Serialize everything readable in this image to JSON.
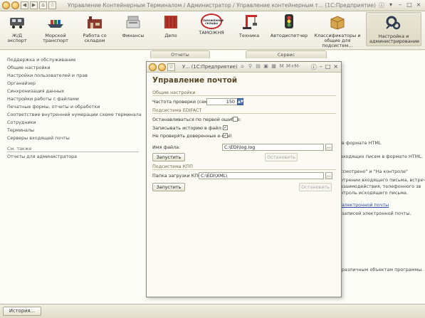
{
  "window": {
    "title": "Управление Контейнерным Терминалом / Администратор / Управление контейнерным т...  (1С:Предприятие)"
  },
  "sections": [
    {
      "label": "Ж/Д\nэкспорт",
      "icon": "train-icon"
    },
    {
      "label": "Морской\nтранспорт",
      "icon": "ship-icon"
    },
    {
      "label": "Работа со\nскладом",
      "icon": "warehouse-icon"
    },
    {
      "label": "Финансы",
      "icon": "finance-icon"
    },
    {
      "label": "Депо",
      "icon": "container-icon"
    },
    {
      "label": "ТАМОЖНЯ",
      "icon": "customs-icon"
    },
    {
      "label": "Техника",
      "icon": "crane-icon"
    },
    {
      "label": "Автодиспетчер",
      "icon": "traffic-light-icon"
    },
    {
      "label": "Классификаторы и\nобщие для подсистем...",
      "icon": "box-icon"
    },
    {
      "label": "Настройка и\nадминистрирование",
      "icon": "settings-icon"
    }
  ],
  "customs_icon_text": "ТАМОЖЕННЫЕ\nСКЛАДЫ",
  "leftpane": {
    "items": [
      "Поддержка и обслуживание",
      "Общие настройки",
      "Настройки пользователей и прав",
      "Органайзер",
      "Синхронизация данных",
      "Настройки работы с файлами",
      "Печатные формы, отчеты и обработки",
      "Соответствие внутренней нумерации схеме терминала",
      "Сотрудники",
      "Терминалы",
      "Серверы входящей почты"
    ],
    "see_also": "См. также",
    "see_also_items": [
      "Отчеты для администратора"
    ]
  },
  "rightpane": {
    "tabs": [
      "Отчеты",
      "Сервис"
    ],
    "fragments": [
      "в формате HTML",
      "входящих писем в формате HTML.",
      "ссмотрено\" и \"На контроле\"",
      "отрении входящего письма, встреч",
      "взаимодействия, телефонного зв",
      "нтроль исходящего письма.",
      "электронной почты",
      "записей электронной почты.",
      "различным объектам программы."
    ]
  },
  "statusbar": {
    "history_button": "История..."
  },
  "modal": {
    "title": "У...  (1С:Предприятие)",
    "tools": [
      "M",
      "M+",
      "M-"
    ],
    "heading": "Управление почтой",
    "group_general": "Общие настройки",
    "check_freq_label": "Частота проверки (сек):",
    "check_freq_value": "150",
    "group_edifact": "Подсистема EDIFACT",
    "stop_on_error_label": "Останавливаться по первой ошибке:",
    "stop_on_error_checked": false,
    "write_history_label": "Записывать историю в файл:",
    "write_history_checked": true,
    "no_trusted_email_label": "Не проверять доверенные e-mail",
    "no_trusted_email_checked": true,
    "file_name_label": "Имя файла:",
    "file_name_value": "C:\\EDI\\log.log",
    "start_button": "Запустить",
    "stop_button": "Остановить",
    "group_kpp": "Подсистема КПП",
    "kpp_folder_label": "Папка загрузки КПП:",
    "kpp_folder_value": "C:\\EDI\\XML\\",
    "kpp_start_button": "Запустить",
    "kpp_stop_button": "Остановить"
  }
}
